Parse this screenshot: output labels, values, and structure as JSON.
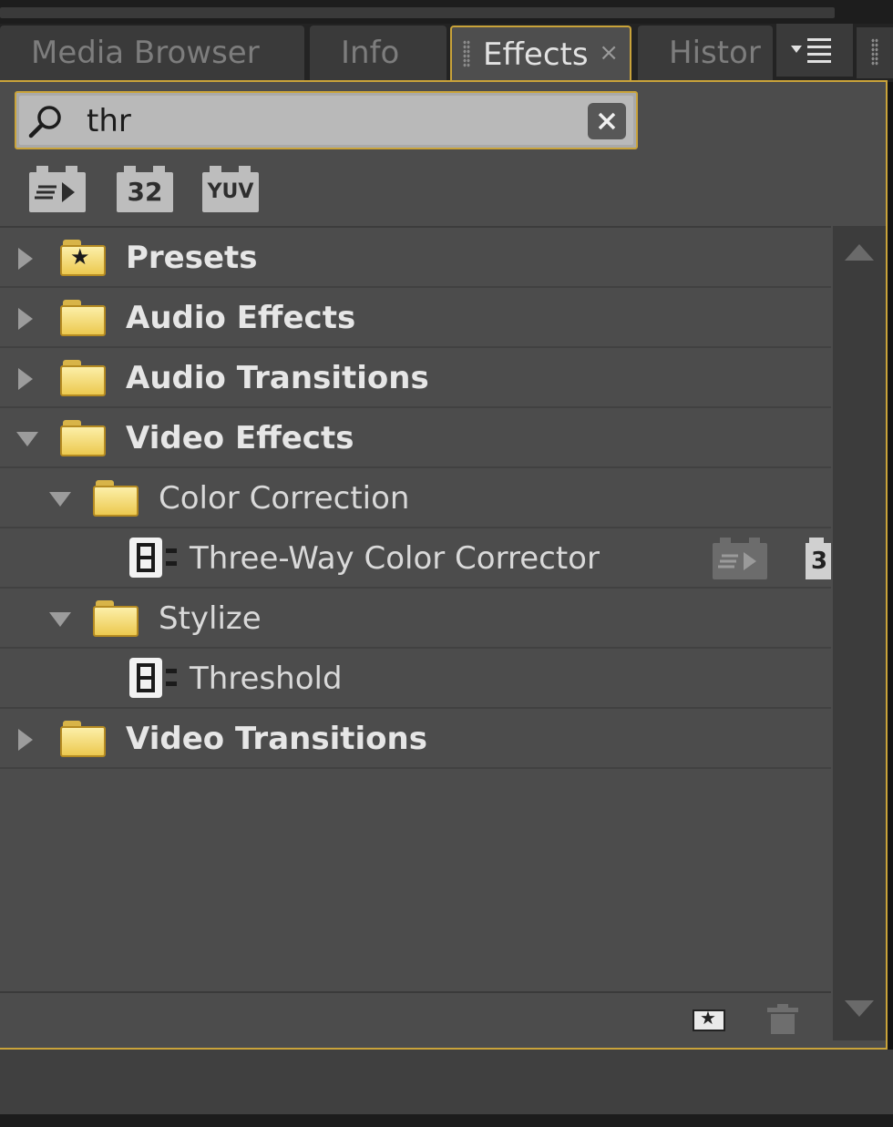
{
  "tabs": [
    {
      "label": "Media Browser",
      "active": false
    },
    {
      "label": "Info",
      "active": false
    },
    {
      "label": "Effects",
      "active": true,
      "close": "×"
    },
    {
      "label": "History",
      "active": false,
      "visible_text": "Histor"
    }
  ],
  "search": {
    "value": "thr"
  },
  "filters": [
    {
      "name": "accelerated-effects",
      "label": ""
    },
    {
      "name": "32-bit-color",
      "label": "32"
    },
    {
      "name": "yuv",
      "label": "YUV"
    }
  ],
  "tree": [
    {
      "label": "Presets",
      "level": 0,
      "expanded": false,
      "type": "preset-folder"
    },
    {
      "label": "Audio Effects",
      "level": 0,
      "expanded": false,
      "type": "folder"
    },
    {
      "label": "Audio Transitions",
      "level": 0,
      "expanded": false,
      "type": "folder"
    },
    {
      "label": "Video Effects",
      "level": 0,
      "expanded": true,
      "type": "folder"
    },
    {
      "label": "Color Correction",
      "level": 1,
      "expanded": true,
      "type": "folder"
    },
    {
      "label": "Three-Way Color Corrector",
      "level": 2,
      "type": "effect",
      "badge_32": "3"
    },
    {
      "label": "Stylize",
      "level": 1,
      "expanded": true,
      "type": "folder"
    },
    {
      "label": "Threshold",
      "level": 2,
      "type": "effect"
    },
    {
      "label": "Video Transitions",
      "level": 0,
      "expanded": false,
      "type": "folder"
    }
  ],
  "colors": {
    "accent": "#c9a33a",
    "panel": "#4c4c4c",
    "folder": "#ecc950"
  }
}
